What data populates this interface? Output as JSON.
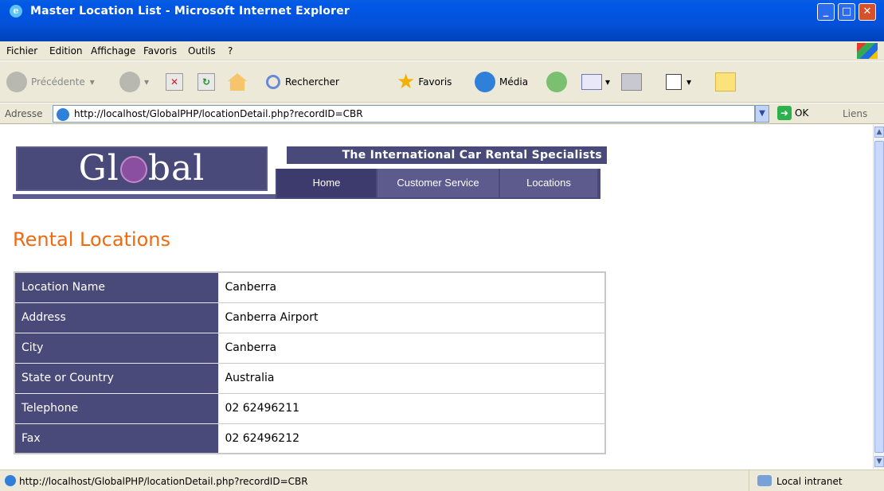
{
  "window": {
    "title": "Master Location List - Microsoft Internet Explorer"
  },
  "menu": [
    "Fichier",
    "Edition",
    "Affichage",
    "Favoris",
    "Outils",
    "?"
  ],
  "toolbar": {
    "back": "Précédente",
    "search": "Rechercher",
    "favorites": "Favoris",
    "media": "Média"
  },
  "address": {
    "label": "Adresse",
    "url": "http://localhost/GlobalPHP/locationDetail.php?recordID=CBR",
    "go": "OK",
    "links": "Liens"
  },
  "site": {
    "logo_left": "Gl",
    "logo_right": "bal",
    "tagline": "The International Car Rental Specialists",
    "nav": [
      "Home",
      "Customer Service",
      "Locations"
    ]
  },
  "page": {
    "title": "Rental Locations"
  },
  "details": [
    {
      "key": "Location Name",
      "value": "Canberra"
    },
    {
      "key": "Address",
      "value": "Canberra Airport"
    },
    {
      "key": "City",
      "value": "Canberra"
    },
    {
      "key": "State or Country",
      "value": "Australia"
    },
    {
      "key": "Telephone",
      "value": "02 62496211"
    },
    {
      "key": "Fax",
      "value": "02 62496212"
    }
  ],
  "status": {
    "text": "http://localhost/GlobalPHP/locationDetail.php?recordID=CBR",
    "zone": "Local intranet"
  }
}
